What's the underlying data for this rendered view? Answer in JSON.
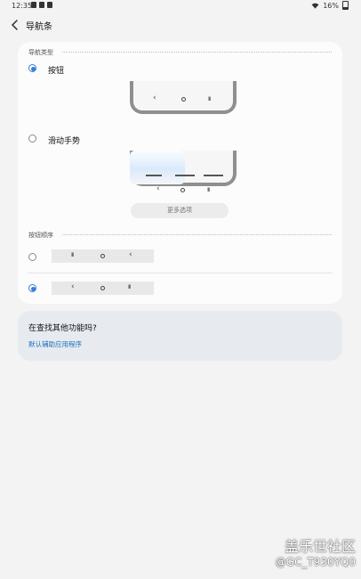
{
  "status_bar": {
    "time": "12:35",
    "battery": "16%"
  },
  "app_bar": {
    "title": "导航条"
  },
  "nav_type": {
    "header": "导航类型",
    "options": [
      {
        "label": "按钮",
        "selected": true
      },
      {
        "label": "滑动手势",
        "selected": false
      }
    ],
    "more_options": "更多选项"
  },
  "button_order": {
    "header": "按钮顺序",
    "options": [
      {
        "icons": [
          "recents-icon",
          "home-icon",
          "back-icon"
        ],
        "selected": false
      },
      {
        "icons": [
          "back-icon",
          "home-icon",
          "recents-icon"
        ],
        "selected": true
      }
    ]
  },
  "help": {
    "question": "在查找其他功能吗?",
    "link": "默认辅助应用程序"
  },
  "watermark": {
    "title": "盖乐世社区",
    "sub": "@GC_T930YQ0"
  },
  "colors": {
    "accent": "#3a7bd5",
    "link": "#1f6fbf",
    "background": "#f3f3f3"
  }
}
